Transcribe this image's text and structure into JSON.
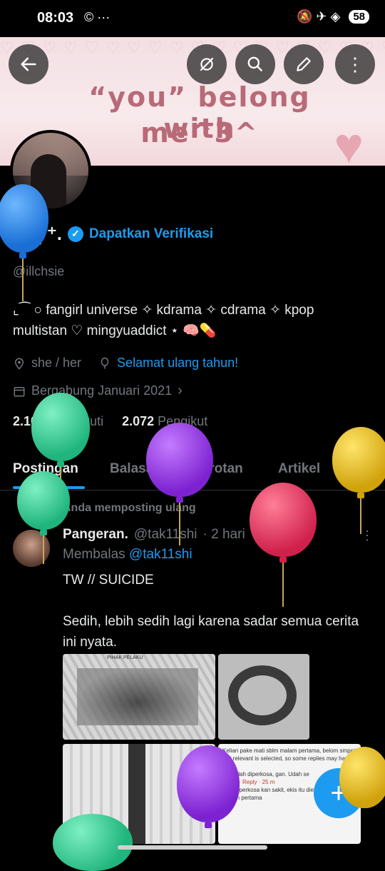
{
  "status_bar": {
    "time": "08:03",
    "left_icons": "© ···",
    "right_icons": "🔕 ✈ ◈",
    "battery": "58"
  },
  "banner": {
    "line1": "“you” belong with",
    "line2": "me^3^"
  },
  "profile": {
    "name": "au⁰̷̸̼̽ ⁺.",
    "verify_link": "Dapatkan Verifikasi",
    "handle": "@illchsie",
    "bio": "⌞⁀ ○ fangirl universe ✧ kdrama ✧ cdrama ✧ kpop multistan ♡ mingyuaddict ⋆ 🧠💊",
    "pronouns": "she / her",
    "birthday": "Selamat ulang tahun!",
    "joined": "Bergabung Januari 2021",
    "following_count": "2.100",
    "following_label": "Mengikuti",
    "followers_count": "2.072",
    "followers_label": "Pengikut"
  },
  "tabs": [
    "Postingan",
    "Balasan",
    "Sorotan",
    "Artikel",
    "Me"
  ],
  "post": {
    "repost_label": "Anda memposting ulang",
    "author": "Pangeran.",
    "author_handle": "@tak11shi",
    "time": "· 2 hari",
    "reply_prefix": "Membalas",
    "reply_to": "@tak11shi",
    "text": "TW // SUICIDE\n\nSedih, lebih sedih lagi karena sadar semua cerita ini nyata.",
    "img1_caption": "PIHAK PELAKU",
    "img4_lines": [
      "Kelian pake mati sblm malam pertama, belom smpet",
      "Not relevant is selected, so some replies may have be",
      "kan udah diperkosa, gan. Udah se",
      "Angry · Reply · 25 m",
      "Pas Diperkosa kan sakit, ekis itu dienakin pas",
      "malam pertama"
    ]
  },
  "icons": {
    "back": "back-arrow-icon",
    "no_notify": "bell-off-icon",
    "search": "search-icon",
    "edit": "pencil-icon",
    "more": "more-vertical-icon",
    "location": "location-pin-icon",
    "birthday": "balloon-icon",
    "calendar": "calendar-icon",
    "repost": "repost-icon"
  },
  "colors": {
    "accent": "#1d9bf0",
    "muted": "#71767b",
    "background": "#000000",
    "text": "#e7e9ea"
  }
}
